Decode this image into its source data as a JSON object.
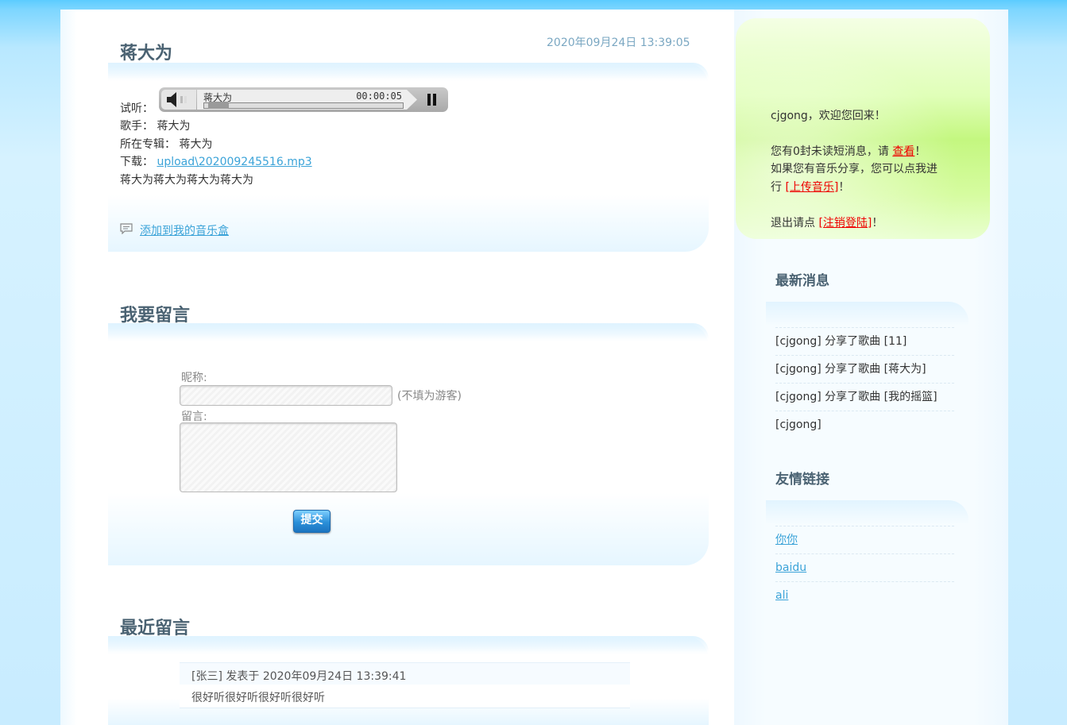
{
  "song": {
    "title": "蒋大为",
    "date": "2020年09月24日 13:39:05",
    "listen_label": "试听：",
    "singer_label": "歌手：",
    "singer": "蒋大为",
    "album_label": "所在专辑：",
    "album": "蒋大为",
    "download_label": "下载：",
    "download_link": "upload\\202009245516.mp3",
    "description": "蒋大为蒋大为蒋大为蒋大为",
    "add_to_box": "添加到我的音乐盒"
  },
  "player": {
    "track_title": "蒋大为",
    "time": "00:00:05",
    "progress": 0.02
  },
  "comment_form": {
    "heading": "我要留言",
    "nickname_label": "昵称:",
    "nickname_value": "",
    "nickname_hint": "(不填为游客)",
    "message_label": "留言:",
    "message_value": "",
    "submit_label": "提交"
  },
  "recent": {
    "heading": "最近留言",
    "items": [
      {
        "header": "[张三] 发表于 2020年09月24日 13:39:41",
        "body": "很好听很好听很好听很好听"
      }
    ]
  },
  "welcome": {
    "greeting": "cjgong，欢迎您回来！",
    "msg_prefix": "您有0封未读短消息，请 ",
    "msg_link": "查看",
    "msg_suffix": "！",
    "share_line1": "如果您有音乐分享，您可以点我进",
    "share_line2_prefix": "行 ",
    "upload_link": "[上传音乐]",
    "share_suffix": "！",
    "logout_prefix": "退出请点 ",
    "logout_link": "[注销登陆]",
    "logout_suffix": "！"
  },
  "news": {
    "heading": "最新消息",
    "items": [
      "[cjgong] 分享了歌曲 [11]",
      "[cjgong] 分享了歌曲 [蒋大为]",
      "[cjgong] 分享了歌曲 [我的摇篮]",
      "[cjgong]"
    ]
  },
  "links": {
    "heading": "友情链接",
    "items": [
      "你你",
      "baidu",
      "ali"
    ]
  }
}
